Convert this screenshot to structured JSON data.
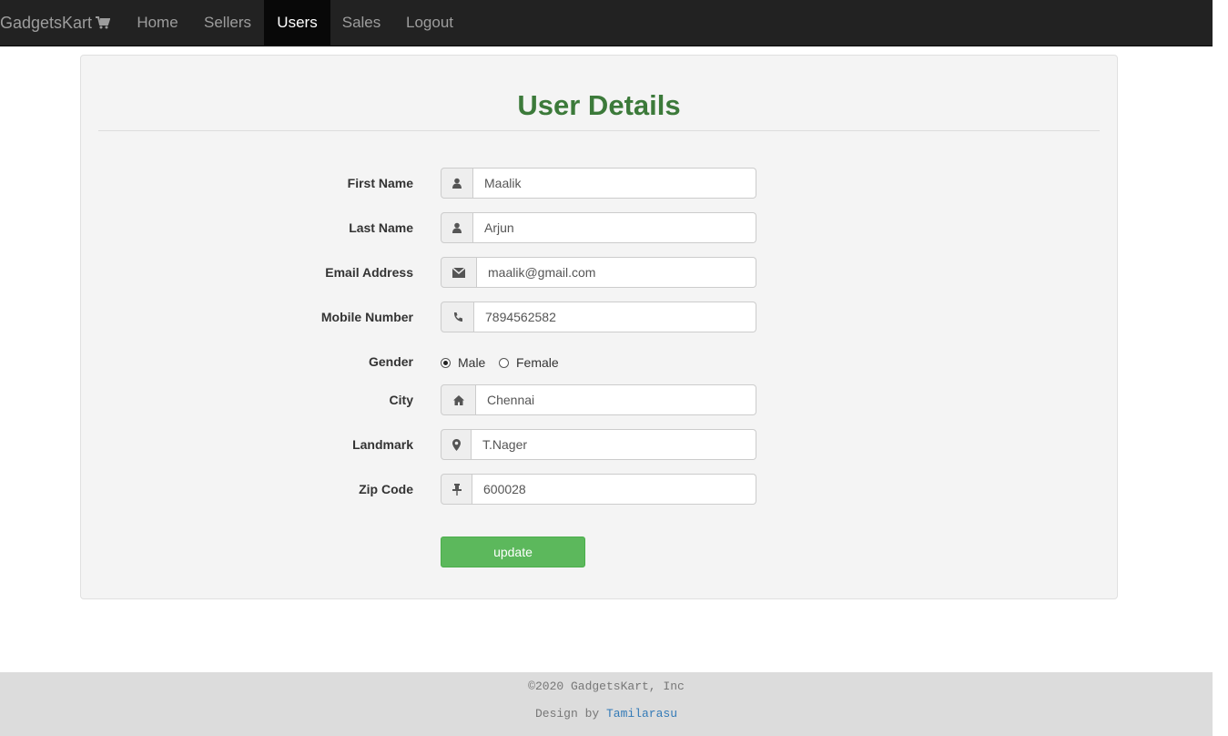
{
  "navbar": {
    "brand": "GadgetsKart",
    "items": [
      {
        "label": "Home",
        "active": false
      },
      {
        "label": "Sellers",
        "active": false
      },
      {
        "label": "Users",
        "active": true
      },
      {
        "label": "Sales",
        "active": false
      },
      {
        "label": "Logout",
        "active": false
      }
    ]
  },
  "form": {
    "title": "User Details",
    "first_name": {
      "label": "First Name",
      "value": "Maalik",
      "icon": "user-icon"
    },
    "last_name": {
      "label": "Last Name",
      "value": "Arjun",
      "icon": "user-icon"
    },
    "email": {
      "label": "Email Address",
      "value": "maalik@gmail.com",
      "icon": "envelope-icon"
    },
    "mobile": {
      "label": "Mobile Number",
      "value": "7894562582",
      "icon": "phone-icon"
    },
    "gender": {
      "label": "Gender",
      "options": [
        "Male",
        "Female"
      ],
      "selected": "Male"
    },
    "city": {
      "label": "City",
      "value": "Chennai",
      "icon": "home-icon"
    },
    "landmark": {
      "label": "Landmark",
      "value": "T.Nager",
      "icon": "map-marker-icon"
    },
    "zip": {
      "label": "Zip Code",
      "value": "600028",
      "icon": "pushpin-icon"
    },
    "submit_label": "update"
  },
  "footer": {
    "copyright": "©2020 GadgetsKart, Inc",
    "design_by": "Design by",
    "designer": "Tamilarasu"
  },
  "colors": {
    "navbar_bg": "#222222",
    "title_green": "#3c7a3a",
    "button_green": "#5cb85c",
    "link_blue": "#337ab7"
  }
}
